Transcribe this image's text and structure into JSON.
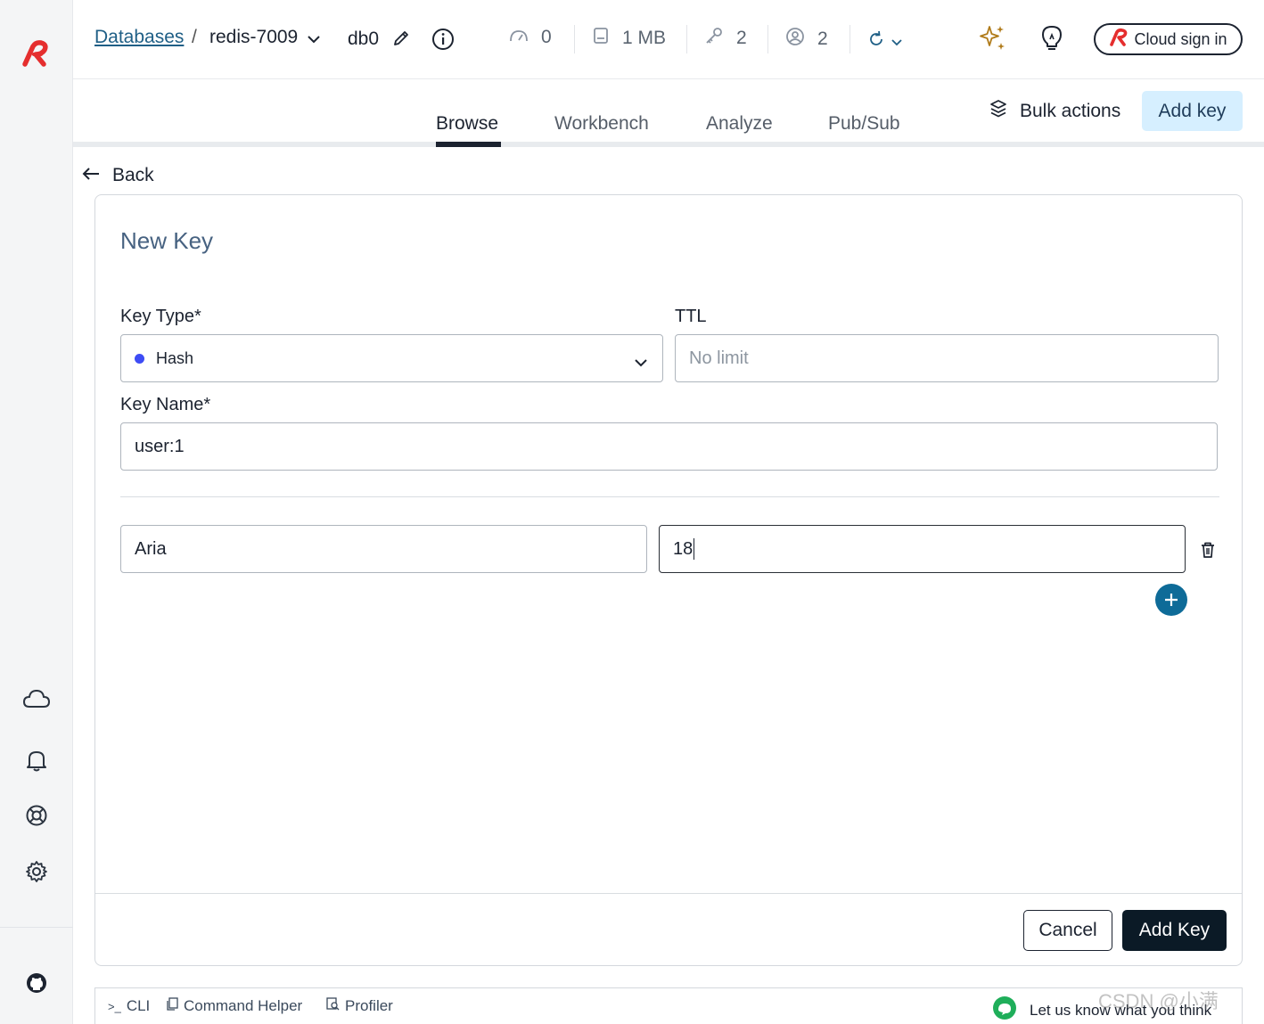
{
  "header": {
    "breadcrumb_link": "Databases",
    "breadcrumb_sep": "/",
    "database_name": "redis-7009",
    "db_index": "db0",
    "stats": {
      "ops": "0",
      "memory": "1 MB",
      "keys": "2",
      "clients": "2"
    },
    "cloud_sign_in": "Cloud sign in"
  },
  "tabs": [
    {
      "label": "Browse",
      "active": true
    },
    {
      "label": "Workbench"
    },
    {
      "label": "Analyze"
    },
    {
      "label": "Pub/Sub"
    }
  ],
  "actions": {
    "bulk_actions": "Bulk actions",
    "add_key": "Add key"
  },
  "back_label": "Back",
  "form": {
    "title": "New Key",
    "key_type_label": "Key Type*",
    "key_type_value": "Hash",
    "ttl_label": "TTL",
    "ttl_placeholder": "No limit",
    "key_name_label": "Key Name*",
    "key_name_value": "user:1",
    "fields": [
      {
        "field": "Aria",
        "value": "18"
      }
    ],
    "cancel": "Cancel",
    "submit": "Add Key"
  },
  "bottom": {
    "cli": "CLI",
    "command_helper": "Command Helper",
    "profiler": "Profiler",
    "feedback": "Let us know what you think"
  },
  "watermark": "CSDN @小满",
  "colors": {
    "brand": "#e52e2e",
    "accent": "#0e6b98",
    "hash_dot": "#3e4cf5"
  }
}
